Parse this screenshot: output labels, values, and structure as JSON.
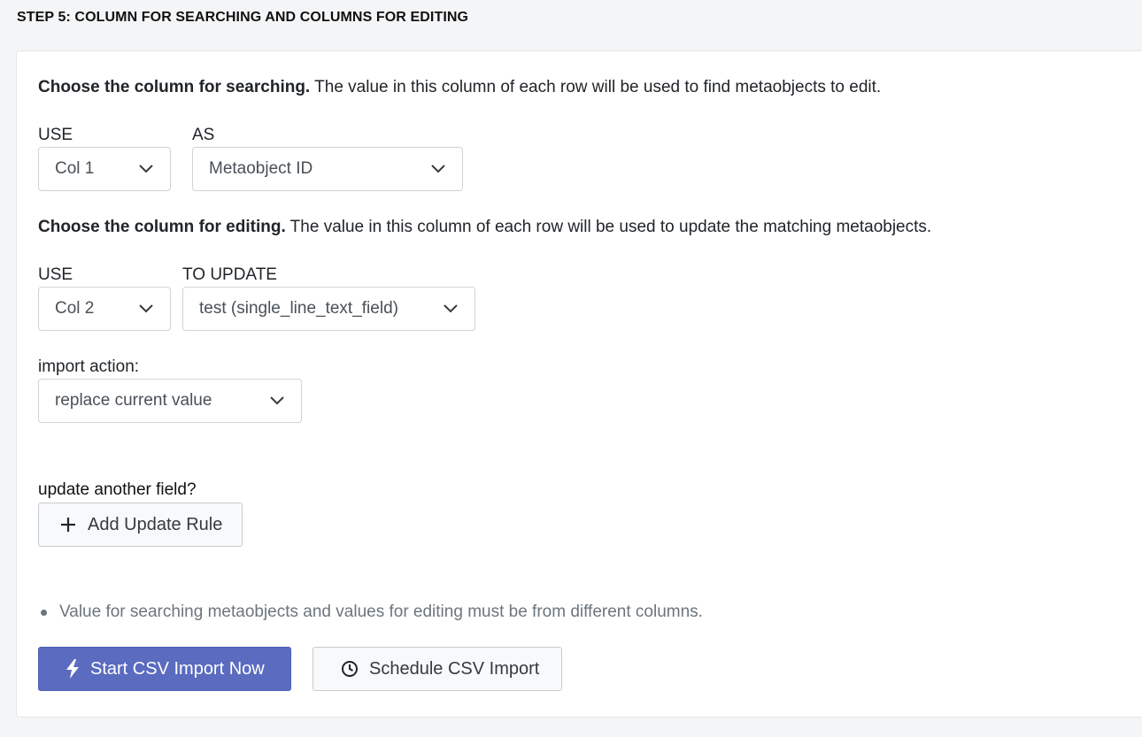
{
  "step_title": "STEP 5: COLUMN FOR SEARCHING AND COLUMNS FOR EDITING",
  "searching": {
    "heading_bold": "Choose the column for searching.",
    "heading_rest": " The value in this column of each row will be used to find metaobjects to edit.",
    "use_label": "USE",
    "use_value": "Col 1",
    "as_label": "AS",
    "as_value": "Metaobject ID"
  },
  "editing": {
    "heading_bold": "Choose the column for editing.",
    "heading_rest": " The value in this column of each row will be used to update the matching metaobjects.",
    "use_label": "USE",
    "use_value": "Col 2",
    "to_update_label": "TO UPDATE",
    "to_update_value": "test (single_line_text_field)",
    "import_action_label": "import action:",
    "import_action_value": "replace current value"
  },
  "another_field": {
    "label": "update another field?",
    "add_rule_label": "Add Update Rule"
  },
  "note": "Value for searching metaobjects and values for editing must be from different columns.",
  "actions": {
    "start_label": "Start CSV Import Now",
    "schedule_label": "Schedule CSV Import"
  },
  "icons": {
    "dropdown": "chevron-down-icon",
    "add": "plus-icon",
    "start": "bolt-icon",
    "schedule": "clock-icon"
  },
  "colors": {
    "primary": "#5b6bc0",
    "page_bg": "#f4f5f7",
    "border": "#ced4da"
  }
}
